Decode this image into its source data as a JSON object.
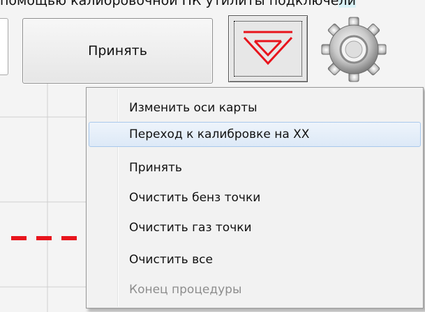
{
  "header": {
    "instruction_prefix": "помощью калибровочной ПК утилиты подключе",
    "highlighted_fragment": "ли"
  },
  "toolbar": {
    "accept_label": "Принять",
    "triangle_button_icon": "red-triangle-down-icon",
    "settings_icon": "gear-icon"
  },
  "context_menu": {
    "items": [
      {
        "label": "Изменить оси карты",
        "state": "normal"
      },
      {
        "label": "Переход к калибровке на XX",
        "state": "hover"
      },
      {
        "label": "Принять",
        "state": "normal"
      },
      {
        "label": "Очистить бенз точки",
        "state": "normal"
      },
      {
        "label": "Очистить газ точки",
        "state": "normal"
      },
      {
        "label": "Очистить все",
        "state": "normal"
      },
      {
        "label": "Конец процедуры",
        "state": "disabled"
      }
    ]
  },
  "colors": {
    "accent_red": "#e8141c",
    "menu_hover_border": "#a8c8ec",
    "disabled_text": "#8d8d8d"
  }
}
